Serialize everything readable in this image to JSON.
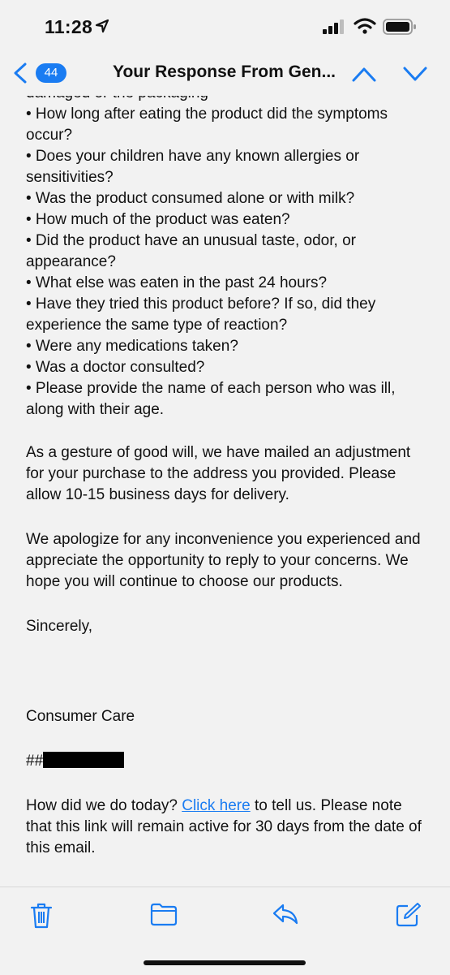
{
  "status": {
    "time": "11:28"
  },
  "nav": {
    "count": "44",
    "title": "Your Response From Gen..."
  },
  "email": {
    "cut_line": "damaged or the packaging",
    "bullets": [
      "• How long after eating the product did the symptoms occur?",
      "• Does your children have any known allergies or sensitivities?",
      "• Was the product consumed alone or with milk?",
      "• How much of the product was eaten?",
      "• Did the product have an unusual taste, odor, or appearance?",
      "• What else was eaten in the past 24 hours?",
      "• Have they tried this product before? If so, did they experience the same type of reaction?",
      "• Were any medications taken?",
      "• Was a doctor consulted?",
      "• Please provide the name of each person who was ill, along with their age."
    ],
    "paragraph_goodwill": "As a gesture of good will, we have mailed an adjustment for your purchase to the address you provided. Please allow 10-15 business days for delivery.",
    "paragraph_apology": "We apologize for any inconvenience you experienced and appreciate the opportunity to reply to your concerns. We hope you will continue to choose our products.",
    "closing": "Sincerely,",
    "signature": "Consumer Care",
    "case_prefix": "##",
    "survey_before": "How did we do today? ",
    "survey_link": "Click here",
    "survey_after": " to tell us. Please note that this link will remain active for 30 days from the date of this email."
  },
  "toolbar": {
    "icons": [
      "trash-icon",
      "folder-icon",
      "reply-icon",
      "compose-icon"
    ],
    "accent": "#1a7cf2"
  }
}
